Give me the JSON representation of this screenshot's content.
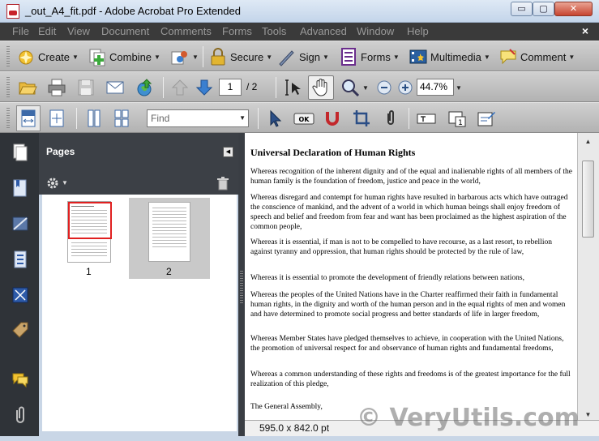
{
  "window": {
    "title": "_out_A4_fit.pdf - Adobe Acrobat Pro Extended"
  },
  "window_buttons": {
    "minimize": "▭",
    "maximize": "▢",
    "close": "✕"
  },
  "menu": {
    "items": [
      "File",
      "Edit",
      "View",
      "Document",
      "Comments",
      "Forms",
      "Tools",
      "Advanced",
      "Window",
      "Help"
    ],
    "close": "×"
  },
  "toolbar_tasks": {
    "create": "Create",
    "combine": "Combine",
    "secure": "Secure",
    "sign": "Sign",
    "forms": "Forms",
    "multimedia": "Multimedia",
    "comment": "Comment"
  },
  "navigation": {
    "current_page": "1",
    "total_pages": "/ 2",
    "zoom": "44.7%"
  },
  "find": {
    "placeholder": "Find"
  },
  "pages_panel": {
    "title": "Pages",
    "thumbnails": [
      {
        "label": "1"
      },
      {
        "label": "2"
      }
    ]
  },
  "document": {
    "title": "Universal Declaration of Human Rights",
    "paragraphs": [
      "Whereas recognition of the inherent dignity and of the equal and inalienable rights of all members of the human family is the foundation of freedom, justice and peace in the world,",
      "Whereas disregard and contempt for human rights have resulted in barbarous acts which have outraged the conscience of mankind, and the advent of a world in which human beings shall enjoy freedom of speech and belief and freedom from fear and want has been proclaimed as the highest aspiration of the common people,",
      "Whereas it is essential, if man is not to be compelled to have recourse, as a last resort, to rebellion against tyranny and oppression, that human rights should be protected by the rule of law,",
      "Whereas it is essential to promote the development of friendly relations between nations,",
      "Whereas the peoples of the United Nations have in the Charter reaffirmed their faith in fundamental human rights, in the dignity and worth of the human person and in the equal rights of men and women and have determined to promote social progress and better standards of life in larger freedom,",
      "Whereas Member States have pledged themselves to achieve, in cooperation with the United Nations, the promotion of universal respect for and observance of human rights and fundamental freedoms,",
      "Whereas a common understanding of these rights and freedoms is of the greatest importance for the full realization of this pledge,",
      "The General Assembly,"
    ]
  },
  "status": {
    "page_size": "595.0 x 842.0 pt"
  },
  "watermark": "© VeryUtils.com",
  "colors": {
    "menubar": "#3a3a3a",
    "panel_dark": "#2f3338",
    "selection_red": "#e02020"
  }
}
